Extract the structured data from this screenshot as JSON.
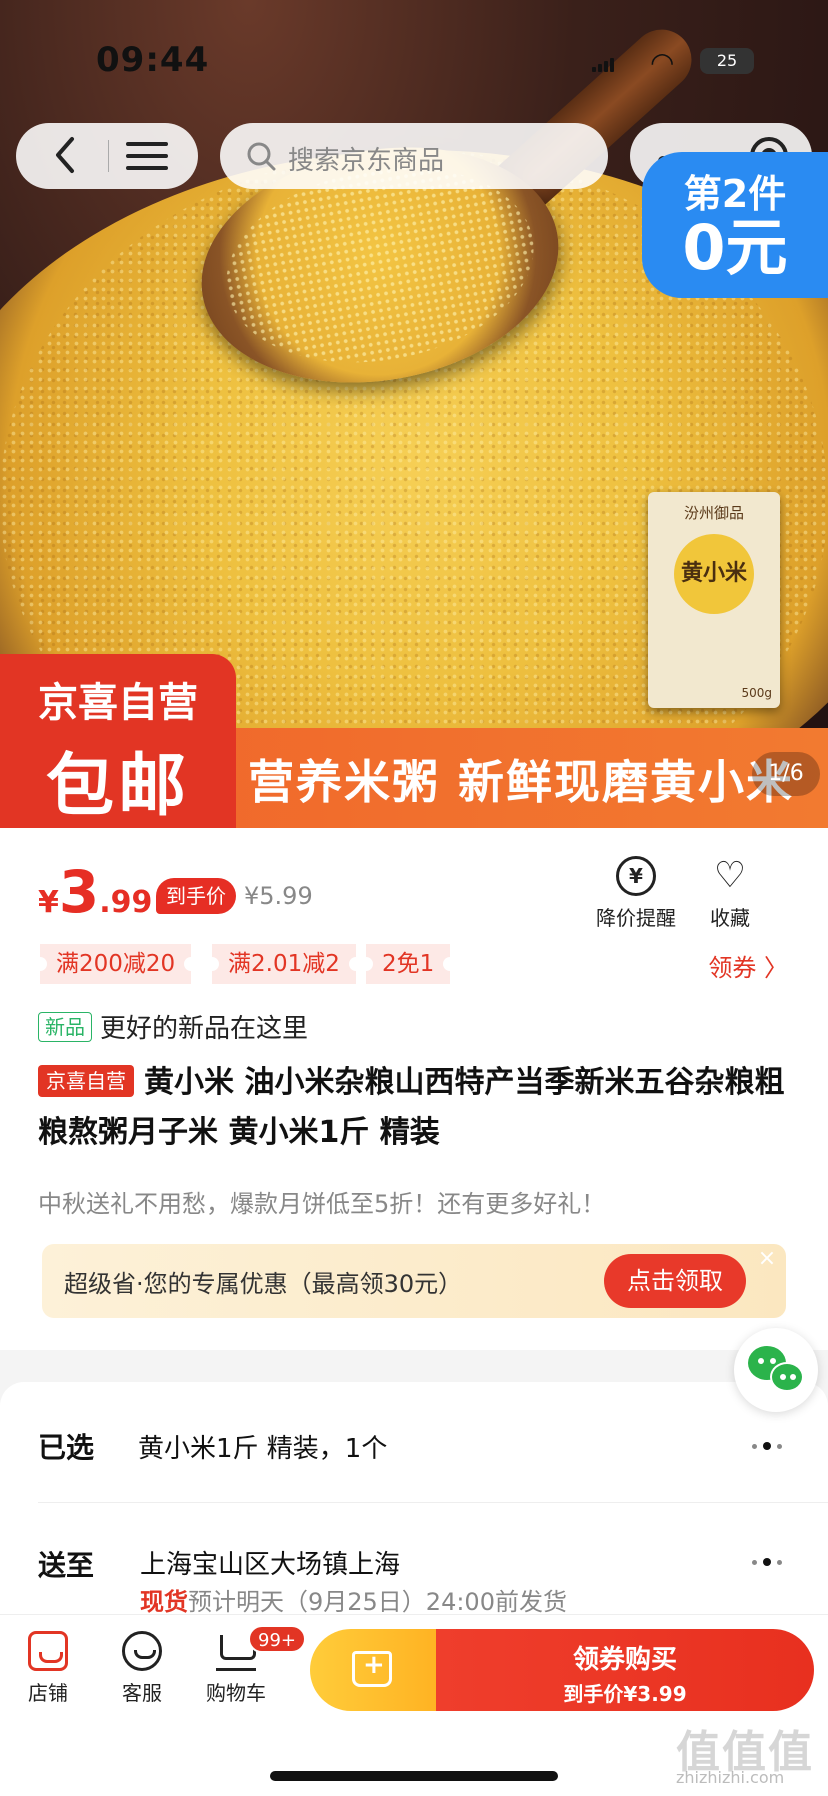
{
  "status": {
    "time": "09:44",
    "battery": "25"
  },
  "nav": {
    "search_placeholder": "搜索京东商品"
  },
  "hero": {
    "promo_line1": "第2件",
    "promo_line2": "0元",
    "package_brand": "汾州御品",
    "package_name": "黄小米",
    "package_weight": "500g",
    "store_tag_line1": "京喜自营",
    "store_tag_line2": "包邮",
    "band_text": "营养米粥  新鲜现磨黄小米",
    "page_indicator": "1/6"
  },
  "price": {
    "currency": "¥",
    "integer": "3",
    "decimal": ".99",
    "final_price_label": "到手价",
    "original_price": "¥5.99"
  },
  "actions": {
    "price_alert_label": "降价提醒",
    "favorite_label": "收藏"
  },
  "coupons": [
    "满200减20",
    "满2.01减2",
    "2免1"
  ],
  "coupon_link": "领券 〉",
  "new_tag": "新品",
  "new_text": "更好的新品在这里",
  "product": {
    "store_badge": "京喜自营",
    "title": "黄小米 油小米杂粮山西特产当季新米五谷杂粮粗粮熬粥月子米 黄小米1斤 精装",
    "subtitle": "中秋送礼不用愁，爆款月饼低至5折！还有更多好礼！"
  },
  "super_save": {
    "text": "超级省·您的专属优惠（最高领30元）",
    "button": "点击领取",
    "close": "×"
  },
  "selection": {
    "selected_label": "已选",
    "selected_value": "黄小米1斤 精装，1个",
    "ship_label": "送至",
    "ship_value": "上海宝山区大场镇上海",
    "stock_status": "现货",
    "delivery_text": "预计明天（9月25日）24:00前发货"
  },
  "bottom_bar": {
    "shop_label": "店铺",
    "service_label": "客服",
    "cart_label": "购物车",
    "cart_badge": "99+",
    "buy_label": "领券购买",
    "buy_sub": "到手价¥3.99"
  },
  "watermark": {
    "main": "值值值",
    "sub": "zhizhizhi.com"
  },
  "colors": {
    "accent_red": "#e23524",
    "promo_blue": "#2a8bf2",
    "band_orange": "#f0642a",
    "cart_yellow": "#ffb323"
  }
}
